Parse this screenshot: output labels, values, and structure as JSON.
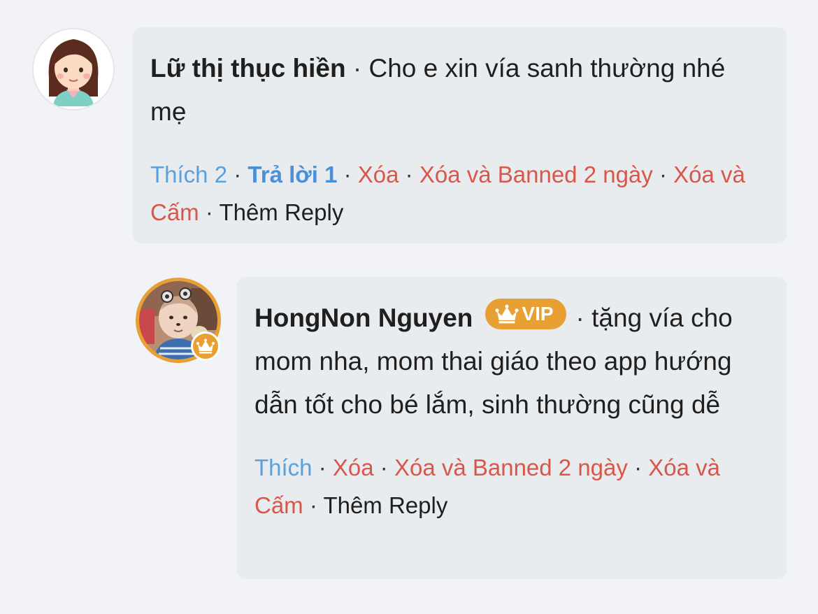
{
  "comments": [
    {
      "author": "Lữ thị thục hiền",
      "text": "Cho e xin vía sanh thường nhé mẹ",
      "avatar_icon": "cartoon-girl-avatar",
      "actions": {
        "like": "Thích 2",
        "reply": "Trả lời 1",
        "delete": "Xóa",
        "delete_ban_2d": "Xóa và Banned 2 ngày",
        "delete_block": "Xóa và Cấm",
        "more_reply": "Thêm Reply"
      }
    },
    {
      "author": "HongNon Nguyen",
      "badge": "VIP",
      "text": "tặng vía cho mom nha, mom thai giáo theo app hướng dẫn tốt cho bé lắm, sinh thường cũng dễ",
      "avatar_icon": "baby-photo-avatar",
      "actions": {
        "like": "Thích",
        "delete": "Xóa",
        "delete_ban_2d": "Xóa và Banned 2 ngày",
        "delete_block": "Xóa và Cấm",
        "more_reply": "Thêm Reply"
      }
    }
  ],
  "separator": "·",
  "colors": {
    "background": "#f2f3f7",
    "bubble": "#e9ecef",
    "like": "#5aa0dc",
    "reply": "#4a90d9",
    "danger": "#d9574a",
    "vip": "#e8a033"
  }
}
